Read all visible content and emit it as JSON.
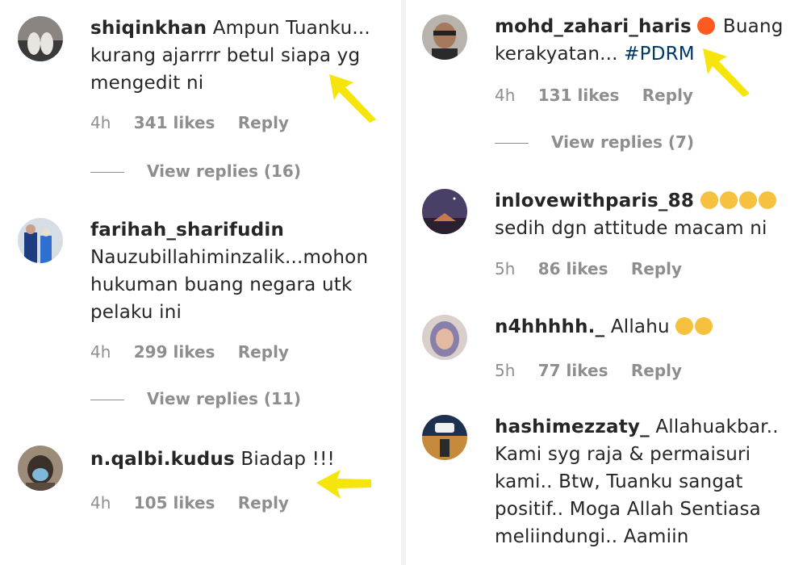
{
  "left": {
    "comments": [
      {
        "username": "shiqinkhan",
        "text": "Ampun Tuanku... kurang ajarrrr betul siapa yg mengedit ni",
        "time": "4h",
        "likes": "341 likes",
        "reply": "Reply",
        "view_replies": "View replies (16)"
      },
      {
        "username": "farihah_sharifudin",
        "text": "Nauzubillahiminzalik...mohon hukuman buang negara utk pelaku ini",
        "time": "4h",
        "likes": "299 likes",
        "reply": "Reply",
        "view_replies": "View replies (11)"
      },
      {
        "username": "n.qalbi.kudus",
        "text": "Biadap !!!",
        "time": "4h",
        "likes": "105 likes",
        "reply": "Reply"
      }
    ]
  },
  "right": {
    "comments": [
      {
        "username": "mohd_zahari_haris",
        "emoji": "angry-face-emoji",
        "text": "Buang kerakyatan...",
        "hashtag": "#PDRM",
        "time": "4h",
        "likes": "131 likes",
        "reply": "Reply",
        "view_replies": "View replies (7)"
      },
      {
        "username": "inlovewithparis_88",
        "emoji": "crying-face-emoji x4",
        "text": "sedih dgn attitude macam ni",
        "time": "5h",
        "likes": "86 likes",
        "reply": "Reply"
      },
      {
        "username": "n4hhhhh._",
        "text": "Allahu",
        "emoji": "sad-face-emoji, crying-face-emoji",
        "time": "5h",
        "likes": "77 likes",
        "reply": "Reply"
      },
      {
        "username": "hashimezzaty_",
        "text": "Allahuakbar.. Kami syg raja & permaisuri kami.. Btw, Tuanku sangat positif.. Moga Allah Sentiasa meliindungi.. Aamiin"
      }
    ]
  },
  "colors": {
    "text": "#262626",
    "meta": "#8e8e8e",
    "hashtag": "#00376b",
    "arrow": "#f5e50a"
  }
}
